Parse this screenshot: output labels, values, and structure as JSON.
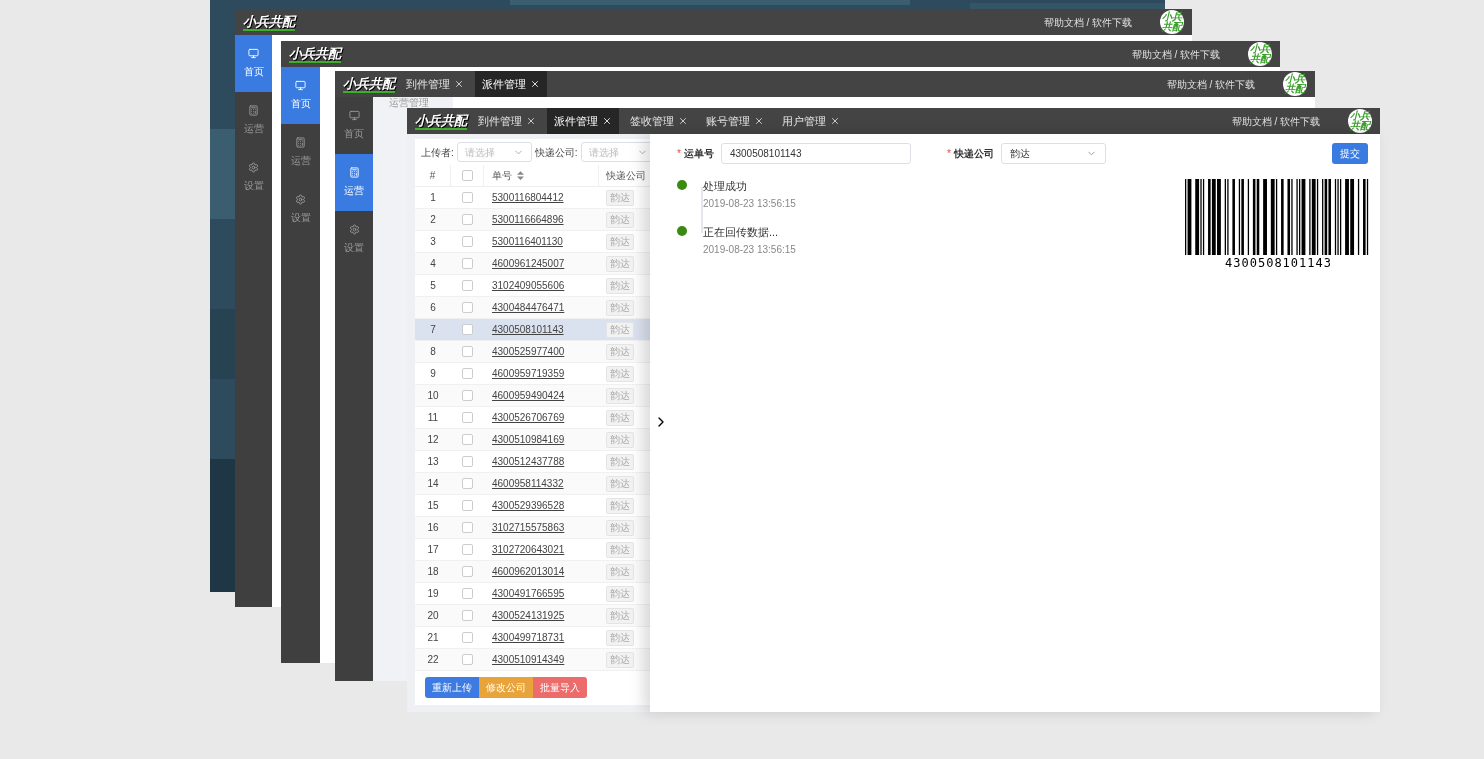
{
  "windows": [
    {
      "logo": "小兵共配",
      "header_link": "帮助文档 / 软件下载",
      "avatar": "小兵共配",
      "sidebar": [
        {
          "label": "首页",
          "selected": true
        },
        {
          "label": "运营",
          "selected": false
        },
        {
          "label": "设置",
          "selected": false
        }
      ]
    },
    {
      "logo": "小兵共配",
      "header_link": "帮助文档 / 软件下载",
      "avatar": "小兵共配",
      "sidebar": [
        {
          "label": "首页",
          "selected": true
        },
        {
          "label": "运营",
          "selected": false
        },
        {
          "label": "设置",
          "selected": false
        }
      ]
    },
    {
      "logo": "小兵共配",
      "tabs": [
        {
          "label": "到件管理",
          "selected": false
        },
        {
          "label": "派件管理",
          "selected": true
        }
      ],
      "header_link": "帮助文档 / 软件下载",
      "avatar": "小兵共配",
      "sidebar": [
        {
          "label": "首页",
          "selected": false
        },
        {
          "label": "运营",
          "selected": true
        },
        {
          "label": "设置",
          "selected": false
        }
      ],
      "breadcrumb": "运营管理"
    },
    {
      "logo": "小兵共配",
      "tabs": [
        {
          "label": "到件管理",
          "selected": false
        },
        {
          "label": "派件管理",
          "selected": true
        },
        {
          "label": "签收管理",
          "selected": false
        },
        {
          "label": "账号管理",
          "selected": false
        },
        {
          "label": "用户管理",
          "selected": false
        }
      ],
      "header_link": "帮助文档 / 软件下载",
      "avatar": "小兵共配",
      "filters": [
        {
          "label": "上传者:",
          "placeholder": "请选择"
        },
        {
          "label": "快递公司:",
          "placeholder": "请选择"
        }
      ],
      "table": {
        "columns": [
          {
            "kind": "text",
            "label": "#"
          },
          {
            "kind": "checkbox",
            "checked": false
          },
          {
            "kind": "text",
            "label": "单号",
            "sortable": true
          },
          {
            "kind": "text",
            "label": "快递公司"
          }
        ],
        "rows": [
          {
            "index": "1",
            "checked": false,
            "number": "5300116804412",
            "company": "韵达",
            "selected": false
          },
          {
            "index": "2",
            "checked": false,
            "number": "5300116664896",
            "company": "韵达",
            "selected": false
          },
          {
            "index": "3",
            "checked": false,
            "number": "5300116401130",
            "company": "韵达",
            "selected": false
          },
          {
            "index": "4",
            "checked": false,
            "number": "4600961245007",
            "company": "韵达",
            "selected": false
          },
          {
            "index": "5",
            "checked": false,
            "number": "3102409055606",
            "company": "韵达",
            "selected": false
          },
          {
            "index": "6",
            "checked": false,
            "number": "4300484476471",
            "company": "韵达",
            "selected": false
          },
          {
            "index": "7",
            "checked": false,
            "number": "4300508101143",
            "company": "韵达",
            "selected": true
          },
          {
            "index": "8",
            "checked": false,
            "number": "4300525977400",
            "company": "韵达",
            "selected": false
          },
          {
            "index": "9",
            "checked": false,
            "number": "4600959719359",
            "company": "韵达",
            "selected": false
          },
          {
            "index": "10",
            "checked": false,
            "number": "4600959490424",
            "company": "韵达",
            "selected": false
          },
          {
            "index": "11",
            "checked": false,
            "number": "4300526706769",
            "company": "韵达",
            "selected": false
          },
          {
            "index": "12",
            "checked": false,
            "number": "4300510984169",
            "company": "韵达",
            "selected": false
          },
          {
            "index": "13",
            "checked": false,
            "number": "4300512437788",
            "company": "韵达",
            "selected": false
          },
          {
            "index": "14",
            "checked": false,
            "number": "4600958114332",
            "company": "韵达",
            "selected": false
          },
          {
            "index": "15",
            "checked": false,
            "number": "4300529396528",
            "company": "韵达",
            "selected": false
          },
          {
            "index": "16",
            "checked": false,
            "number": "3102715575863",
            "company": "韵达",
            "selected": false
          },
          {
            "index": "17",
            "checked": false,
            "number": "3102720643021",
            "company": "韵达",
            "selected": false
          },
          {
            "index": "18",
            "checked": false,
            "number": "4600962013014",
            "company": "韵达",
            "selected": false
          },
          {
            "index": "19",
            "checked": false,
            "number": "4300491766595",
            "company": "韵达",
            "selected": false
          },
          {
            "index": "20",
            "checked": false,
            "number": "4300524131925",
            "company": "韵达",
            "selected": false
          },
          {
            "index": "21",
            "checked": false,
            "number": "4300499718731",
            "company": "韵达",
            "selected": false
          },
          {
            "index": "22",
            "checked": false,
            "number": "4300510914349",
            "company": "韵达",
            "selected": false
          }
        ]
      },
      "actions": [
        {
          "label": "重新上传",
          "color": "#3d7be3"
        },
        {
          "label": "修改公司",
          "color": "#e8a33a"
        },
        {
          "label": "批量导入",
          "color": "#ec6b6b"
        }
      ],
      "drawer": {
        "fields": [
          {
            "kind": "input",
            "required_mark": "*",
            "label": "运单号",
            "value": "4300508101143"
          },
          {
            "kind": "select",
            "required_mark": "*",
            "label": "快递公司",
            "value": "韵达"
          }
        ],
        "submit": "提交",
        "timeline": [
          {
            "title": "处理成功",
            "time": "2019-08-23 13:56:15"
          },
          {
            "title": "正在回传数据...",
            "time": "2019-08-23 13:56:15"
          }
        ],
        "barcode": "4300508101143"
      }
    }
  ]
}
